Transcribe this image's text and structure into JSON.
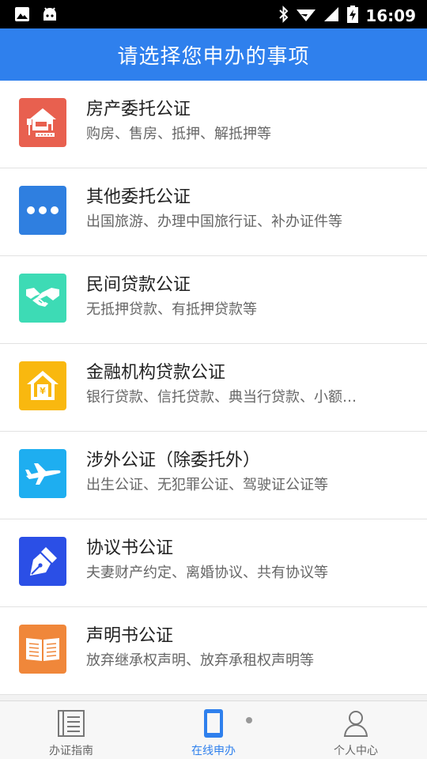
{
  "status_bar": {
    "time": "16:09"
  },
  "header": {
    "title": "请选择您申办的事项"
  },
  "items": [
    {
      "name": "房产委托公证",
      "desc": "购房、售房、抵押、解抵押等",
      "color": "#e8604f",
      "icon": "house-icon"
    },
    {
      "name": "其他委托公证",
      "desc": "出国旅游、办理中国旅行证、补办证件等",
      "color": "#2f7fe0",
      "icon": "more-dots-icon"
    },
    {
      "name": "民间贷款公证",
      "desc": "无抵押贷款、有抵押贷款等",
      "color": "#3ddbb5",
      "icon": "handshake-icon"
    },
    {
      "name": "金融机构贷款公证",
      "desc": "银行贷款、信托贷款、典当行贷款、小额贷款等",
      "color": "#f9b80f",
      "icon": "bank-house-icon"
    },
    {
      "name": "涉外公证（除委托外）",
      "desc": "出生公证、无犯罪公证、驾驶证公证等",
      "color": "#1eaef0",
      "icon": "airplane-icon"
    },
    {
      "name": "协议书公证",
      "desc": "夫妻财产约定、离婚协议、共有协议等",
      "color": "#2b4fe6",
      "icon": "pen-icon"
    },
    {
      "name": "声明书公证",
      "desc": "放弃继承权声明、放弃承租权声明等",
      "color": "#f0873a",
      "icon": "book-icon"
    }
  ],
  "tabs": [
    {
      "label": "办证指南",
      "icon": "guide-list-icon"
    },
    {
      "label": "在线申办",
      "icon": "phone-icon",
      "active": true
    },
    {
      "label": "个人中心",
      "icon": "user-icon"
    }
  ]
}
